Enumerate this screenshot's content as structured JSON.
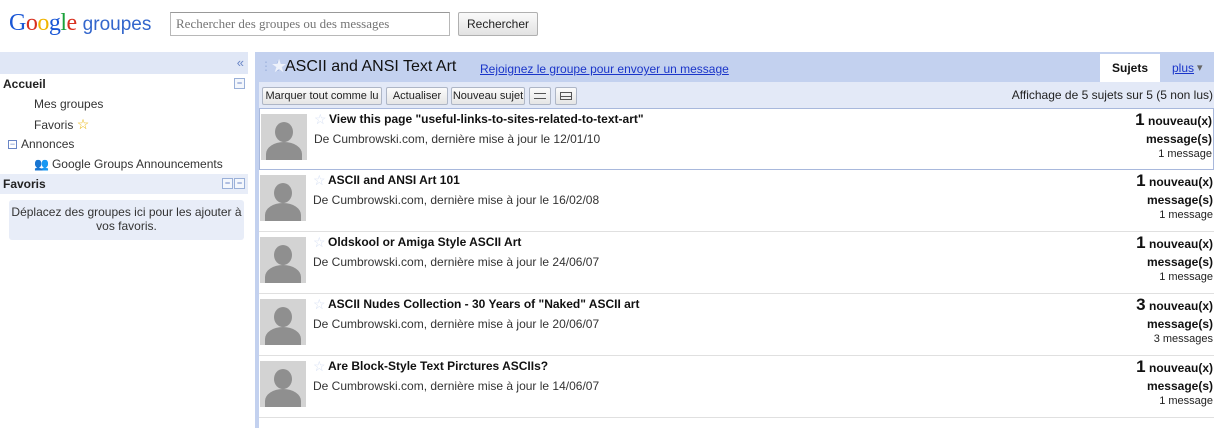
{
  "header": {
    "logo": {
      "g1": "G",
      "o1": "o",
      "o2": "o",
      "g2": "g",
      "l": "l",
      "e": "e",
      "product": "groupes"
    },
    "search_placeholder": "Rechercher des groupes ou des messages",
    "search_button": "Rechercher"
  },
  "sidebar": {
    "collapse_icon": "«",
    "accueil": "Accueil",
    "mes_groupes": "Mes groupes",
    "favoris_link": "Favoris",
    "annonces": "Annonces",
    "announcements": "Google Groups Announcements",
    "favoris_section": "Favoris",
    "fav_drop_text": "Déplacez des groupes ici pour les ajouter à vos favoris."
  },
  "main": {
    "group_title": "ASCII and ANSI Text Art",
    "join_link": "Rejoignez le groupe pour envoyer un message",
    "tab_sujets": "Sujets",
    "tab_plus": "plus",
    "toolbar": {
      "mark_read": "Marquer tout comme lu",
      "refresh": "Actualiser",
      "new_topic": "Nouveau sujet"
    },
    "count_text": "Affichage de 5 sujets sur 5 (5 non lus)",
    "topics": [
      {
        "title": "View this page \"useful-links-to-sites-related-to-text-art\"",
        "meta": "De Cumbrowski.com, dernière mise à jour le 12/01/10",
        "count": "1",
        "new_label": "nouveau(x)",
        "messages_label": "message(s)",
        "total": "1 message"
      },
      {
        "title": "ASCII and ANSI Art 101",
        "meta": "De Cumbrowski.com, dernière mise à jour le 16/02/08",
        "count": "1",
        "new_label": "nouveau(x)",
        "messages_label": "message(s)",
        "total": "1 message"
      },
      {
        "title": "Oldskool or Amiga Style ASCII Art",
        "meta": "De Cumbrowski.com, dernière mise à jour le 24/06/07",
        "count": "1",
        "new_label": "nouveau(x)",
        "messages_label": "message(s)",
        "total": "1 message"
      },
      {
        "title": "ASCII Nudes Collection - 30 Years of \"Naked\" ASCII art",
        "meta": "De Cumbrowski.com, dernière mise à jour le 20/06/07",
        "count": "3",
        "new_label": "nouveau(x)",
        "messages_label": "message(s)",
        "total": "3 messages"
      },
      {
        "title": "Are Block-Style Text Pirctures ASCIIs?",
        "meta": "De Cumbrowski.com, dernière mise à jour le 14/06/07",
        "count": "1",
        "new_label": "nouveau(x)",
        "messages_label": "message(s)",
        "total": "1 message"
      }
    ]
  }
}
